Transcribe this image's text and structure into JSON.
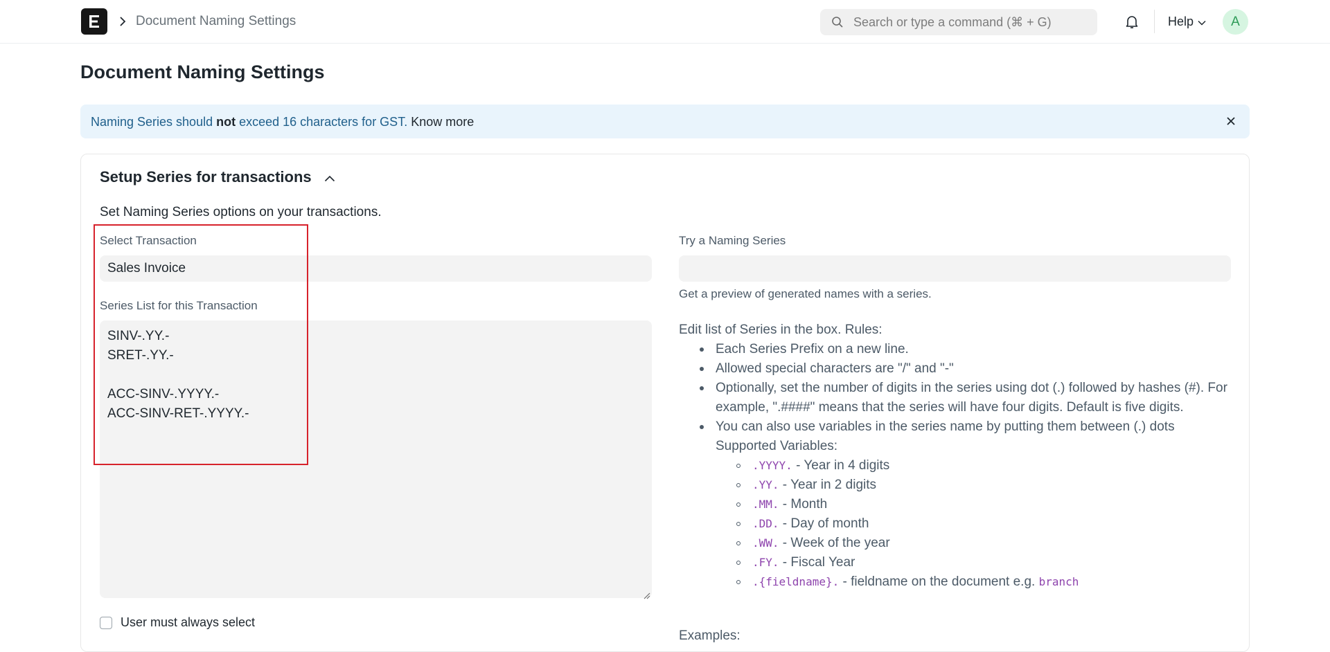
{
  "navbar": {
    "breadcrumb": "Document Naming Settings",
    "search_placeholder": "Search or type a command (⌘ + G)",
    "help_label": "Help",
    "avatar_initial": "A"
  },
  "page": {
    "title": "Document Naming Settings"
  },
  "alert": {
    "text_before": "Naming Series should ",
    "text_bold": "not",
    "text_after": " exceed 16 characters for GST. ",
    "link": "Know more"
  },
  "section": {
    "title": "Setup Series for transactions",
    "description": "Set Naming Series options on your transactions."
  },
  "form": {
    "select_transaction_label": "Select Transaction",
    "select_transaction_value": "Sales Invoice",
    "series_list_label": "Series List for this Transaction",
    "series_list_value": "SINV-.YY.-\nSRET-.YY.-\n\nACC-SINV-.YYYY.-\nACC-SINV-RET-.YYYY.-",
    "user_must_select_label": "User must always select",
    "try_series_label": "Try a Naming Series",
    "try_series_value": "",
    "try_series_hint": "Get a preview of generated names with a series."
  },
  "rules": {
    "heading": "Edit list of Series in the box. Rules:",
    "items": [
      "Each Series Prefix on a new line.",
      "Allowed special characters are \"/\" and \"-\"",
      "Optionally, set the number of digits in the series using dot (.) followed by hashes (#). For example, \".####\" means that the series will have four digits. Default is five digits.",
      "You can also use variables in the series name by putting them between (.) dots"
    ],
    "supported_label": "Supported Variables:",
    "variables": [
      {
        "code": ".YYYY.",
        "desc": " - Year in 4 digits"
      },
      {
        "code": ".YY.",
        "desc": " - Year in 2 digits"
      },
      {
        "code": ".MM.",
        "desc": " - Month"
      },
      {
        "code": ".DD.",
        "desc": " - Day of month"
      },
      {
        "code": ".WW.",
        "desc": " - Week of the year"
      },
      {
        "code": ".FY.",
        "desc": " - Fiscal Year"
      },
      {
        "code": ".{fieldname}.",
        "desc": " - fieldname on the document e.g. ",
        "extra_code": "branch"
      }
    ],
    "examples_label": "Examples:"
  }
}
